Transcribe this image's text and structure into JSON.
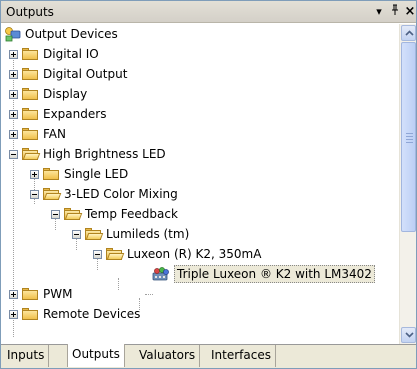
{
  "window": {
    "title": "Outputs",
    "dropdown_glyph": "▾",
    "pin_glyph": "ᵖ",
    "close_glyph": "×"
  },
  "tree": {
    "root": "Output Devices",
    "items": [
      {
        "label": "Digital IO",
        "icon": "folder-icon",
        "expanded": false
      },
      {
        "label": "Digital Output",
        "icon": "folder-icon",
        "expanded": false
      },
      {
        "label": "Display",
        "icon": "folder-icon",
        "expanded": false
      },
      {
        "label": "Expanders",
        "icon": "folder-icon",
        "expanded": false
      },
      {
        "label": "FAN",
        "icon": "folder-icon",
        "expanded": false
      },
      {
        "label": "High Brightness LED",
        "icon": "open-folder-icon",
        "expanded": true
      },
      {
        "label": "Single LED",
        "icon": "folder-icon",
        "expanded": false
      },
      {
        "label": "3-LED Color Mixing",
        "icon": "open-folder-icon",
        "expanded": true
      },
      {
        "label": "Temp Feedback",
        "icon": "open-folder-icon",
        "expanded": true
      },
      {
        "label": "Lumileds (tm)",
        "icon": "open-folder-icon",
        "expanded": true
      },
      {
        "label": "Luxeon (R) K2, 350mA",
        "icon": "open-folder-icon",
        "expanded": true
      },
      {
        "label": "Triple Luxeon ® K2 with LM3402",
        "icon": "device-icon",
        "selected": true
      },
      {
        "label": "PWM",
        "icon": "folder-icon",
        "expanded": false
      },
      {
        "label": "Remote Devices",
        "icon": "folder-icon",
        "expanded": false
      }
    ]
  },
  "tabs": [
    {
      "label": "Inputs",
      "active": false
    },
    {
      "label": "Outputs",
      "active": true
    },
    {
      "label": "Valuators",
      "active": false
    },
    {
      "label": "Interfaces",
      "active": false
    }
  ],
  "colors": {
    "selection": "#ece9d8",
    "folder": "#f0c04a",
    "scroll": "#bccff5"
  }
}
